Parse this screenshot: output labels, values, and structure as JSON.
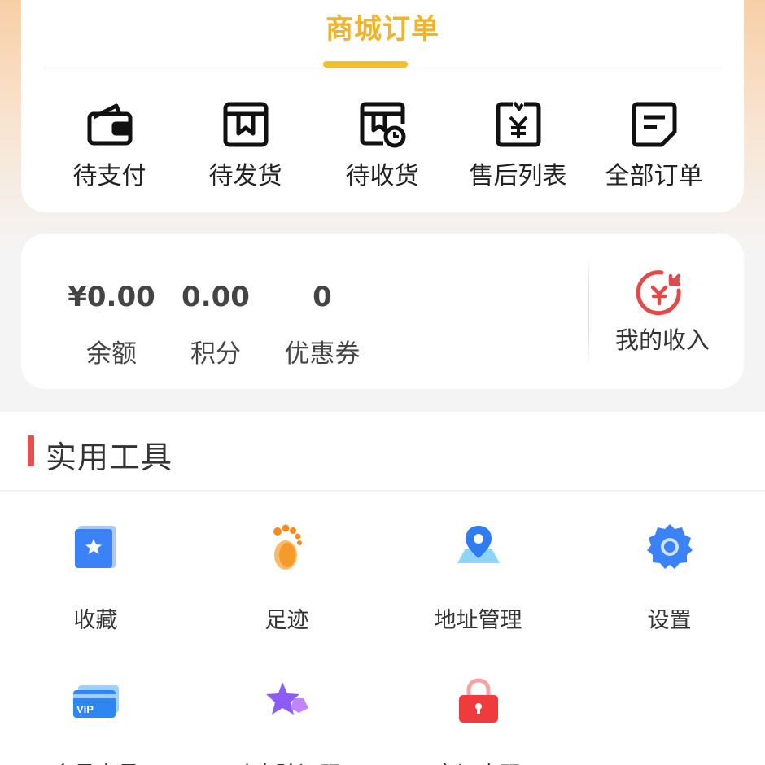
{
  "orders": {
    "title": "商城订单",
    "items": [
      {
        "label": "待支付",
        "icon": "wallet-icon"
      },
      {
        "label": "待发货",
        "icon": "package-icon"
      },
      {
        "label": "待收货",
        "icon": "delivery-clock-icon"
      },
      {
        "label": "售后列表",
        "icon": "refund-receipt-icon"
      },
      {
        "label": "全部订单",
        "icon": "document-icon"
      }
    ]
  },
  "assets": {
    "items": [
      {
        "value": "¥0.00",
        "label": "余额"
      },
      {
        "value": "0.00",
        "label": "积分"
      },
      {
        "value": "0",
        "label": "优惠券"
      }
    ],
    "income": {
      "label": "我的收入",
      "icon": "income-icon"
    }
  },
  "tools": {
    "title": "实用工具",
    "items": [
      {
        "label": "收藏",
        "icon": "star-bookmark-icon"
      },
      {
        "label": "足迹",
        "icon": "footprint-icon"
      },
      {
        "label": "地址管理",
        "icon": "map-pin-icon"
      },
      {
        "label": "设置",
        "icon": "gear-icon"
      },
      {
        "label": "会员卡号",
        "icon": "vip-card-icon",
        "icon_text": "VIP"
      },
      {
        "label": "动态验证码",
        "icon": "dynamic-star-icon"
      },
      {
        "label": "忘记密码",
        "icon": "lock-icon"
      }
    ]
  },
  "colors": {
    "accent": "#f0b428",
    "income_red": "#e24a4a",
    "tools_bar": "#e25050"
  }
}
